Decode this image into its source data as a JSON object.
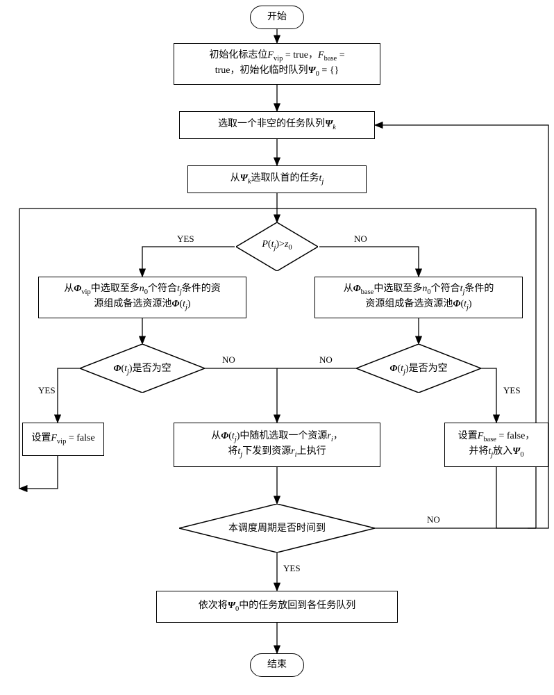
{
  "chart_data": {
    "type": "flowchart",
    "nodes": [
      {
        "id": "start",
        "type": "terminator",
        "label": "开始"
      },
      {
        "id": "init",
        "type": "process",
        "label": "初始化标志位Fvip = true，Fbase = true，初始化临时队列Ψ0 = {}"
      },
      {
        "id": "select_queue",
        "type": "process",
        "label": "选取一个非空的任务队列Ψk"
      },
      {
        "id": "select_task",
        "type": "process",
        "label": "从Ψk选取队首的任务tj"
      },
      {
        "id": "check_priority",
        "type": "decision",
        "label": "P(tj)>z0"
      },
      {
        "id": "select_vip",
        "type": "process",
        "label": "从Φvip中选取至多n0个符合tj条件的资源组成备选资源池Φ(tj)"
      },
      {
        "id": "select_base",
        "type": "process",
        "label": "从Φbase中选取至多n0个符合tj条件的资源组成备选资源池Φ(tj)"
      },
      {
        "id": "vip_empty",
        "type": "decision",
        "label": "Φ(tj)是否为空"
      },
      {
        "id": "base_empty",
        "type": "decision",
        "label": "Φ(tj)是否为空"
      },
      {
        "id": "set_vip_false",
        "type": "process",
        "label": "设置Fvip = false"
      },
      {
        "id": "set_base_false",
        "type": "process",
        "label": "设置Fbase = false，并将tj放入Ψ0"
      },
      {
        "id": "dispatch",
        "type": "process",
        "label": "从Φ(tj)中随机选取一个资源ri，将tj下发到资源ri上执行"
      },
      {
        "id": "time_up",
        "type": "decision",
        "label": "本调度周期是否时间到"
      },
      {
        "id": "restore",
        "type": "process",
        "label": "依次将Ψ0中的任务放回到各任务队列"
      },
      {
        "id": "end",
        "type": "terminator",
        "label": "结束"
      }
    ],
    "edges": [
      {
        "from": "start",
        "to": "init"
      },
      {
        "from": "init",
        "to": "select_queue"
      },
      {
        "from": "select_queue",
        "to": "select_task"
      },
      {
        "from": "select_task",
        "to": "check_priority"
      },
      {
        "from": "check_priority",
        "to": "select_vip",
        "label": "YES"
      },
      {
        "from": "check_priority",
        "to": "select_base",
        "label": "NO"
      },
      {
        "from": "select_vip",
        "to": "vip_empty"
      },
      {
        "from": "select_base",
        "to": "base_empty"
      },
      {
        "from": "vip_empty",
        "to": "set_vip_false",
        "label": "YES"
      },
      {
        "from": "vip_empty",
        "to": "dispatch",
        "label": "NO"
      },
      {
        "from": "base_empty",
        "to": "dispatch",
        "label": "NO"
      },
      {
        "from": "base_empty",
        "to": "set_base_false",
        "label": "YES"
      },
      {
        "from": "set_vip_false",
        "to": "check_priority"
      },
      {
        "from": "set_base_false",
        "to": "time_up"
      },
      {
        "from": "dispatch",
        "to": "time_up"
      },
      {
        "from": "time_up",
        "to": "select_queue",
        "label": "NO"
      },
      {
        "from": "time_up",
        "to": "restore",
        "label": "YES"
      },
      {
        "from": "restore",
        "to": "end"
      }
    ]
  },
  "nodes": {
    "start": "开始",
    "end": "结束",
    "init_line1": "初始化标志位",
    "init_fvip": "F",
    "init_vip_sub": "vip",
    "init_eq_true1": " = true，",
    "init_fbase": "F",
    "init_base_sub": "base",
    "init_eq_true2": " = ",
    "init_line2": "true，初始化临时队列",
    "init_psi0": "Ψ",
    "init_0": "0",
    "init_empty": " = {}",
    "sel_queue_1": "选取一个非空的任务队列",
    "sel_queue_psi": "Ψ",
    "sel_queue_k": "k",
    "sel_task_1": "从",
    "sel_task_psi": "Ψ",
    "sel_task_k": "k",
    "sel_task_2": "选取队首的任务",
    "sel_task_t": "t",
    "sel_task_j": "j",
    "prio_p": "P",
    "prio_t": "t",
    "prio_j": "j",
    "prio_gt": ")>",
    "prio_z": "z",
    "prio_0": "0",
    "vip_1": "从",
    "vip_phi": "Φ",
    "vip_sub": "vip",
    "vip_2": "中选取至多",
    "vip_n": "n",
    "vip_n0": "0",
    "vip_3": "个符合",
    "vip_t": "t",
    "vip_j": "j",
    "vip_4": "条件的资",
    "vip_5": "源组成备选资源池",
    "vip_phi2": "Φ",
    "vip_t2": "t",
    "vip_j2": "j",
    "base_1": "从",
    "base_phi": "Φ",
    "base_sub": "base",
    "base_2": "中选取至多",
    "base_n": "n",
    "base_n0": "0",
    "base_3": "个符合",
    "base_t": "t",
    "base_j": "j",
    "base_4": "条件的",
    "base_5": "资源组成备选资源池",
    "base_phi2": "Φ",
    "base_t2": "t",
    "base_j2": "j",
    "empty_phi": "Φ",
    "empty_t": "t",
    "empty_j": "j",
    "empty_q": ")是否为空",
    "set_vip_1": "设置",
    "set_vip_f": "F",
    "set_vip_sub": "vip",
    "set_vip_2": " = false",
    "set_base_1": "设置",
    "set_base_f": "F",
    "set_base_sub": "base",
    "set_base_2": " = false，",
    "set_base_3": "并将",
    "set_base_t": "t",
    "set_base_j": "j",
    "set_base_4": "放入",
    "set_base_psi": "Ψ",
    "set_base_0": "0",
    "disp_1": "从",
    "disp_phi": "Φ",
    "disp_t": "t",
    "disp_j": "j",
    "disp_2": ")中随机选取一个资源",
    "disp_r": "r",
    "disp_i": "i",
    "disp_comma": "，",
    "disp_3": "将",
    "disp_t2": "t",
    "disp_j2": "j",
    "disp_4": "下发到资源",
    "disp_r2": "r",
    "disp_i2": "i",
    "disp_5": "上执行",
    "time_q": "本调度周期是否时间到",
    "restore_1": "依次将",
    "restore_psi": "Ψ",
    "restore_0": "0",
    "restore_2": "中的任务放回到各任务队列"
  },
  "labels": {
    "yes": "YES",
    "no": "NO"
  }
}
